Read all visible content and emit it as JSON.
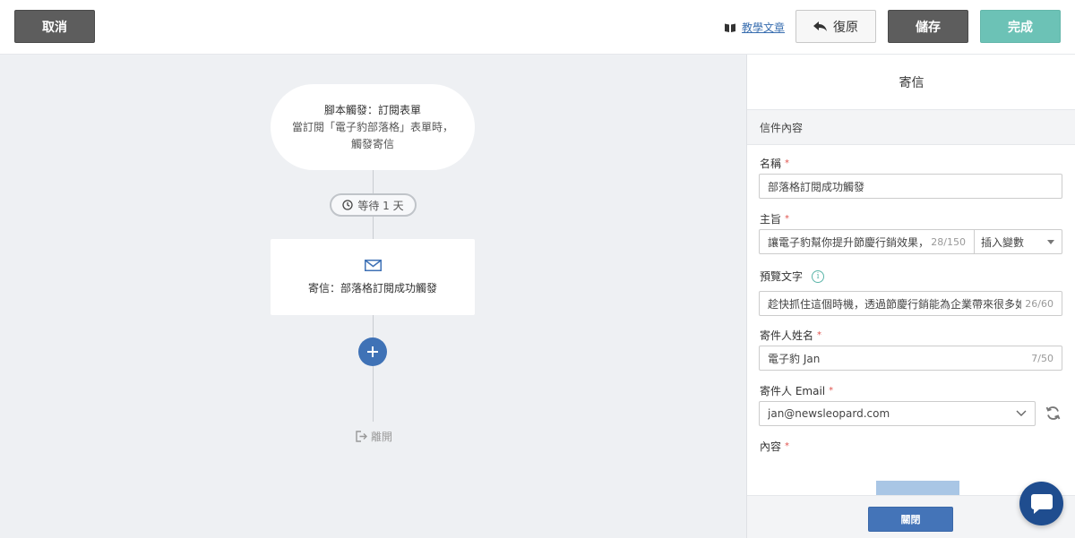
{
  "toolbar": {
    "cancel_label": "取消",
    "tutorial_label": "教學文章",
    "undo_label": "復原",
    "save_label": "儲存",
    "done_label": "完成"
  },
  "flow": {
    "trigger_title": "腳本觸發：訂閱表單",
    "trigger_desc_line1": "當訂閱「電子豹部落格」表單時，",
    "trigger_desc_line2": "觸發寄信",
    "wait_label": "等待 1 天",
    "email_label": "寄信：部落格訂閱成功觸發",
    "exit_label": "離開"
  },
  "panel": {
    "title": "寄信",
    "section": "信件內容",
    "name_label": "名稱",
    "name_value": "部落格訂閱成功觸發",
    "subject_label": "主旨",
    "subject_value": "讓電子豹幫你提升節慶行銷效果，",
    "subject_counter": "28/150",
    "insert_var_label": "插入變數",
    "preview_label": "預覽文字",
    "preview_value": "趁快抓住這個時機，透過節慶行銷能為企業帶來很多如",
    "preview_counter": "26/60",
    "sender_name_label": "寄件人姓名",
    "sender_name_value": "電子豹 Jan",
    "sender_name_counter": "7/50",
    "sender_email_label": "寄件人 Email",
    "sender_email_value": "jan@newsleopard.com",
    "content_label": "內容",
    "required_mark": "*",
    "close_label": "關閉"
  },
  "colors": {
    "accent_teal": "#6cc2b6",
    "primary_blue": "#3f72b6",
    "dark_button": "#5d5d5d",
    "required_red": "#e0544f"
  }
}
